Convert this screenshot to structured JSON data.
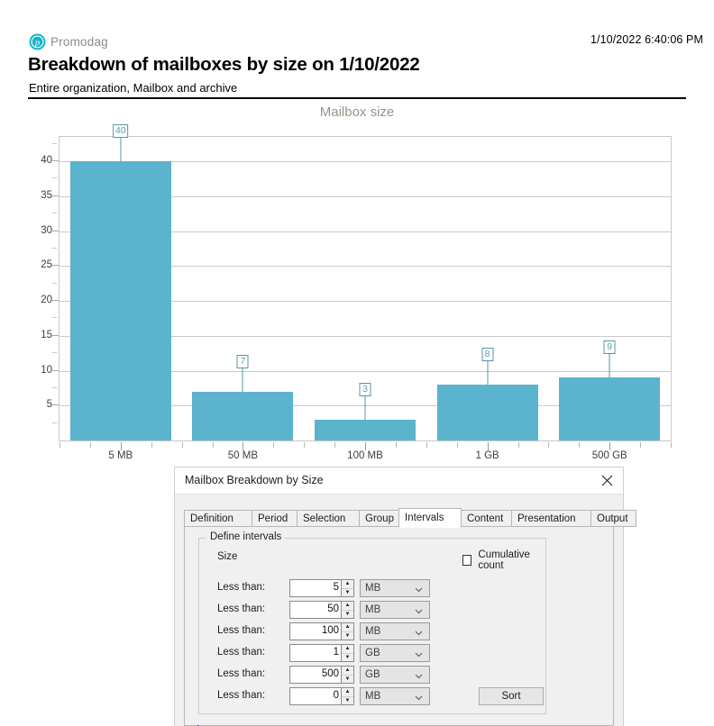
{
  "report": {
    "brand_name": "Promodag",
    "brand_icon": "promodag-logo-icon",
    "date": "1/10/2022 6:40:06 PM",
    "title": "Breakdown of mailboxes by size on 1/10/2022",
    "subtitle": "Entire organization, Mailbox and archive"
  },
  "chart_data": {
    "type": "bar",
    "title": "Mailbox size",
    "categories": [
      "5 MB",
      "50 MB",
      "100 MB",
      "1 GB",
      "500 GB"
    ],
    "values": [
      40,
      7,
      3,
      8,
      9
    ],
    "labels": [
      "40",
      "7",
      "3",
      "8",
      "9"
    ],
    "xlabel": "",
    "ylabel": "",
    "ylim": [
      0,
      43.5
    ],
    "yticks": [
      5,
      10,
      15,
      20,
      25,
      30,
      35,
      40
    ],
    "ytick_labels": [
      "5",
      "10",
      "15",
      "20",
      "25",
      "30",
      "35",
      "40"
    ],
    "y_minor_step": 2.5,
    "grid": true,
    "legend": false,
    "bar_color": "#5bb3cd",
    "label_border_color": "#5794a8",
    "label_text_color": "#5b9bb0",
    "grid_color": "#c9c9c9",
    "title_color": "#9b9287"
  },
  "dialog": {
    "title": "Mailbox Breakdown by Size",
    "close_icon": "close-icon",
    "tabs": [
      {
        "label": "Definition",
        "active": false
      },
      {
        "label": "Period",
        "active": false
      },
      {
        "label": "Selection",
        "active": false
      },
      {
        "label": "Group",
        "active": false
      },
      {
        "label": "Intervals",
        "active": true
      },
      {
        "label": "Content",
        "active": false
      },
      {
        "label": "Presentation",
        "active": false
      },
      {
        "label": "Output",
        "active": false
      }
    ],
    "groupbox": {
      "legend": "Define intervals",
      "size_label": "Size",
      "cumulative_label": "Cumulative count",
      "cumulative_checked": false,
      "rows": [
        {
          "label": "Less than:",
          "value": "5",
          "unit": "MB"
        },
        {
          "label": "Less than:",
          "value": "50",
          "unit": "MB"
        },
        {
          "label": "Less than:",
          "value": "100",
          "unit": "MB"
        },
        {
          "label": "Less than:",
          "value": "1",
          "unit": "GB"
        },
        {
          "label": "Less than:",
          "value": "500",
          "unit": "GB"
        },
        {
          "label": "Less than:",
          "value": "0",
          "unit": "MB"
        }
      ],
      "sort_label": "Sort"
    }
  }
}
